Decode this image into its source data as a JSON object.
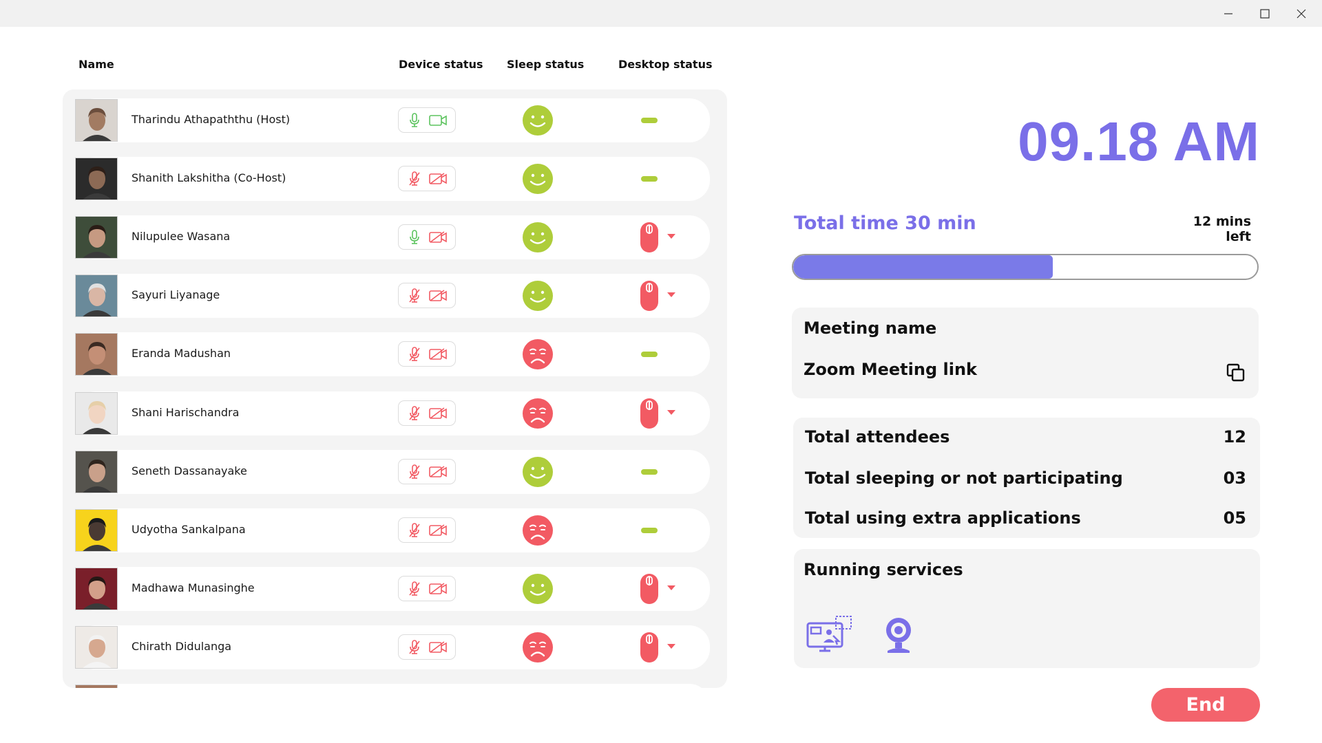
{
  "window": {
    "minimize": "minimize",
    "maximize": "maximize",
    "close": "close"
  },
  "columns": {
    "name": "Name",
    "device": "Device status",
    "sleep": "Sleep status",
    "desktop": "Desktop status"
  },
  "participants": [
    {
      "name": "Tharindu Athapaththu (Host)",
      "mic": "on",
      "camera": "on",
      "sleep": "awake",
      "desktop": "normal"
    },
    {
      "name": "Shanith Lakshitha (Co-Host)",
      "mic": "off",
      "camera": "off",
      "sleep": "awake",
      "desktop": "normal"
    },
    {
      "name": "Nilupulee Wasana",
      "mic": "on",
      "camera": "off",
      "sleep": "awake",
      "desktop": "extra-apps"
    },
    {
      "name": "Sayuri Liyanage",
      "mic": "off",
      "camera": "off",
      "sleep": "awake",
      "desktop": "extra-apps"
    },
    {
      "name": "Eranda Madushan",
      "mic": "off",
      "camera": "off",
      "sleep": "sleeping",
      "desktop": "normal"
    },
    {
      "name": "Shani Harischandra",
      "mic": "off",
      "camera": "off",
      "sleep": "sleeping",
      "desktop": "extra-apps"
    },
    {
      "name": "Seneth Dassanayake",
      "mic": "off",
      "camera": "off",
      "sleep": "awake",
      "desktop": "normal"
    },
    {
      "name": "Udyotha Sankalpana",
      "mic": "off",
      "camera": "off",
      "sleep": "sleeping",
      "desktop": "normal"
    },
    {
      "name": "Madhawa Munasinghe",
      "mic": "off",
      "camera": "off",
      "sleep": "awake",
      "desktop": "extra-apps"
    },
    {
      "name": "Chirath Didulanga",
      "mic": "off",
      "camera": "off",
      "sleep": "sleeping",
      "desktop": "extra-apps"
    }
  ],
  "clock": "09.18 AM",
  "timer": {
    "total_label": "Total time 30 min",
    "left_label": "12 mins left",
    "progress": 0.56
  },
  "meeting": {
    "name_label": "Meeting name",
    "link_label": "Zoom Meeting link",
    "copy_icon": "copy-icon"
  },
  "stats": [
    {
      "label": "Total attendees",
      "value": "12"
    },
    {
      "label": "Total sleeping or not participating",
      "value": "03"
    },
    {
      "label": "Total using extra applications",
      "value": "05"
    }
  ],
  "services": {
    "title": "Running services",
    "icons": [
      "screen-share-icon",
      "webcam-icon"
    ]
  },
  "end_button": "End",
  "colors": {
    "accent": "#7a6fe8",
    "green": "#aecd3a",
    "red": "#f25a63",
    "mic_green": "#5cc35e"
  }
}
